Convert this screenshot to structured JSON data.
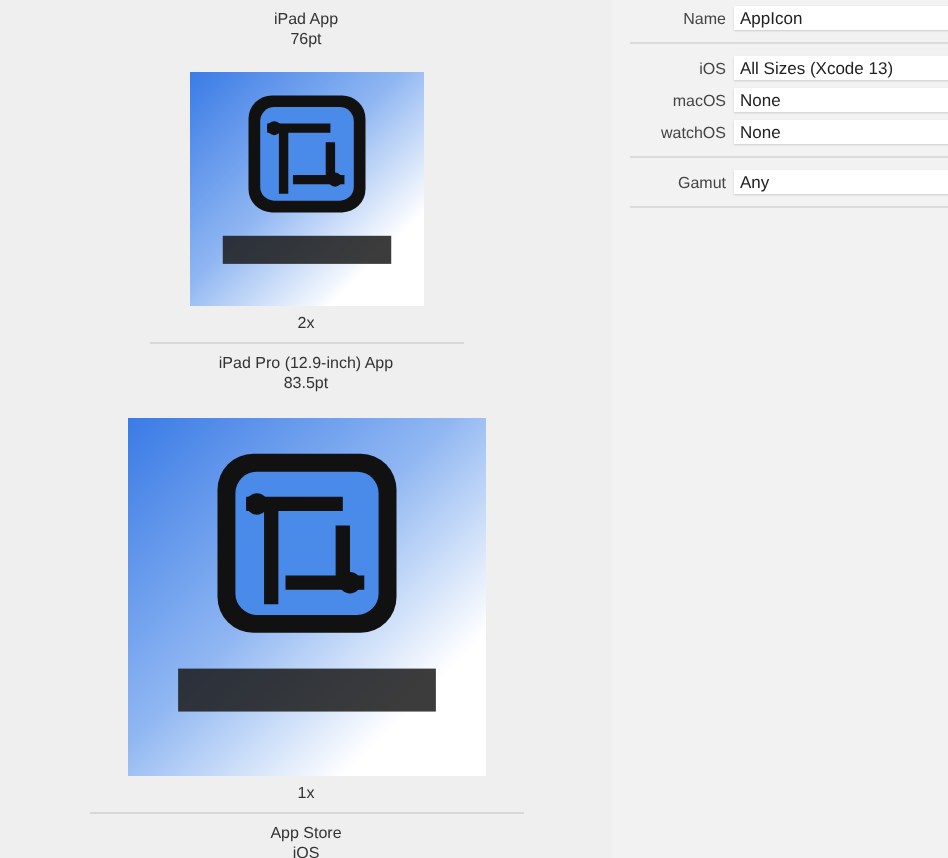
{
  "slots": [
    {
      "kind": "caption",
      "title": "iPad App",
      "size": "76pt"
    },
    {
      "scale": "2x",
      "large": false
    },
    {
      "kind": "caption",
      "title": "iPad Pro (12.9-inch) App",
      "size": "83.5pt"
    },
    {
      "scale": "1x",
      "large": true
    },
    {
      "kind": "caption",
      "title": "App Store",
      "size": "iOS"
    }
  ],
  "inspector": {
    "name": {
      "label": "Name",
      "value": "AppIcon"
    },
    "platforms": [
      {
        "label": "iOS",
        "value": "All Sizes (Xcode 13)"
      },
      {
        "label": "macOS",
        "value": "None"
      },
      {
        "label": "watchOS",
        "value": "None"
      }
    ],
    "gamut": {
      "label": "Gamut",
      "value": "Any"
    }
  }
}
